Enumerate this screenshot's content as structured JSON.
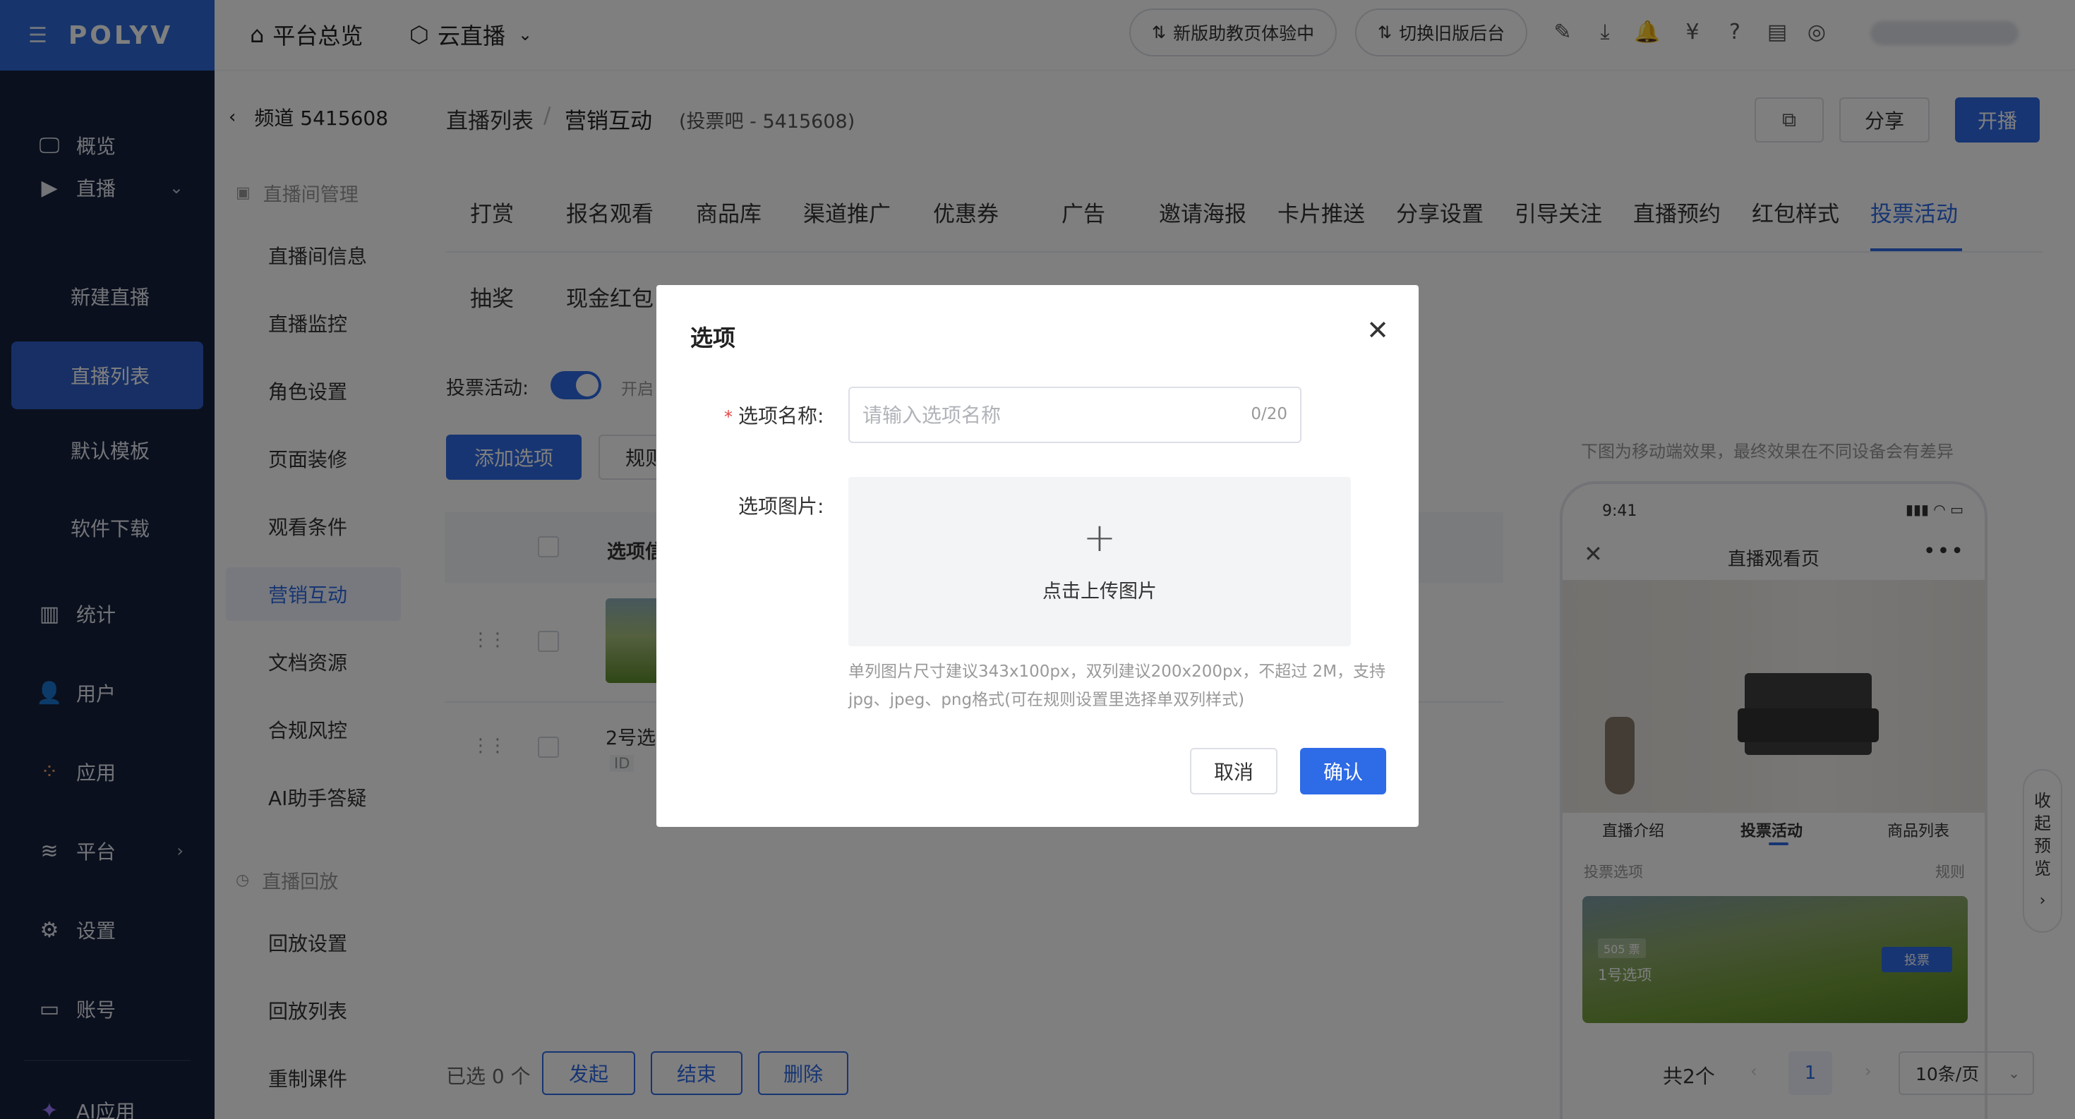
{
  "left_nav": {
    "brand": "POLYV",
    "items": [
      {
        "label": "概览"
      },
      {
        "label": "直播"
      },
      {
        "label": "新建直播"
      },
      {
        "label": "直播列表"
      },
      {
        "label": "默认模板"
      },
      {
        "label": "软件下载"
      },
      {
        "label": "统计"
      },
      {
        "label": "用户"
      },
      {
        "label": "应用"
      },
      {
        "label": "平台"
      },
      {
        "label": "设置"
      },
      {
        "label": "账号"
      },
      {
        "label": "AI应用"
      }
    ]
  },
  "header": {
    "home": "平台总览",
    "cloud": "云直播",
    "pill_new": "新版助教页体验中",
    "pill_old": "切换旧版后台"
  },
  "sub_nav": {
    "channel": "频道 5415608",
    "section_manage": "直播间管理",
    "items": [
      "直播间信息",
      "直播监控",
      "角色设置",
      "页面装修",
      "观看条件",
      "营销互动",
      "文档资源",
      "合规风控",
      "AI助手答疑"
    ],
    "section_replay": "直播回放",
    "replay_items": [
      "回放设置",
      "回放列表",
      "重制课件"
    ]
  },
  "content": {
    "breadcrumb_1": "直播列表",
    "breadcrumb_sep": "/",
    "breadcrumb_2": "营销互动",
    "breadcrumb_meta": "(投票吧 - 5415608)",
    "share": "分享",
    "start": "开播",
    "tabs_row1": [
      "打赏",
      "报名观看",
      "商品库",
      "渠道推广",
      "优惠券",
      "广告",
      "邀请海报",
      "卡片推送",
      "分享设置",
      "引导关注",
      "直播预约",
      "红包样式",
      "投票活动"
    ],
    "tabs_row2": [
      "抽奖",
      "现金红包"
    ],
    "vote_label": "投票活动:",
    "switch_text": "开启",
    "add_option": "添加选项",
    "rules": "规则",
    "col_option": "选项信",
    "row2_name": "2号选",
    "row2_id": "ID",
    "preview_note": "下图为移动端效果，最终效果在不同设备会有差异",
    "collapse_preview": [
      "收",
      "起",
      "预",
      "览"
    ],
    "footer": {
      "selected": "已选 0 个",
      "launch": "发起",
      "end": "结束",
      "delete": "删除",
      "total": "共2个",
      "page": "1",
      "page_size": "10条/页"
    }
  },
  "phone": {
    "time": "9:41",
    "title": "直播观看页",
    "tabs": [
      "直播介绍",
      "投票活动",
      "商品列表"
    ],
    "vote_options": "投票选项",
    "rules": "规则",
    "votes": "505 票",
    "option_name": "1号选项",
    "vote_btn": "投票"
  },
  "dialog": {
    "title": "选项",
    "name_label": "选项名称:",
    "name_placeholder": "请输入选项名称",
    "name_value": "",
    "counter": "0/20",
    "image_label": "选项图片:",
    "upload_text": "点击上传图片",
    "hint": "单列图片尺寸建议343x100px，双列建议200x200px，不超过 2M，支持jpg、jpeg、png格式(可在规则设置里选择单双列样式)",
    "cancel": "取消",
    "confirm": "确认"
  },
  "colors": {
    "primary": "#2e6be6",
    "nav_bg": "#15203c",
    "logo_bg": "#2f6ad8"
  }
}
